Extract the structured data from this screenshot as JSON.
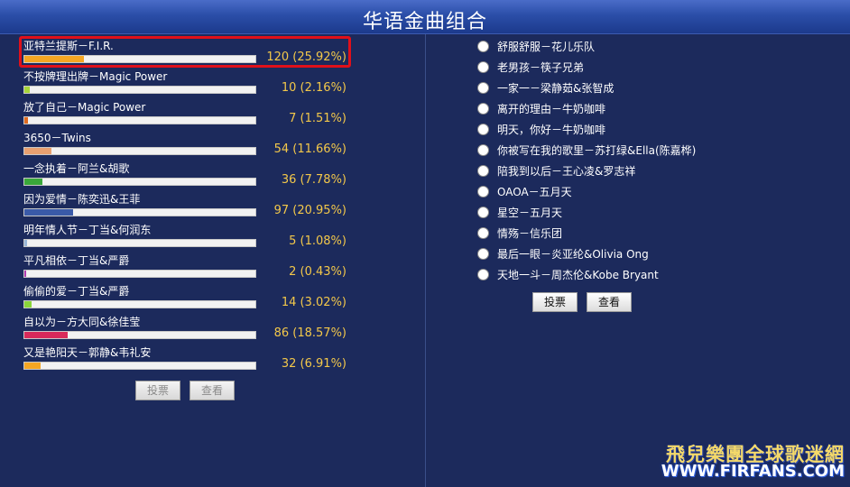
{
  "header": {
    "title": "华语金曲组合"
  },
  "results": [
    {
      "label": "亚特兰提斯－F.I.R.",
      "value": "120 (25.92%)",
      "percent": 25.92,
      "color": "#f5a623"
    },
    {
      "label": "不按牌理出牌－Magic Power",
      "value": "10 (2.16%)",
      "percent": 2.16,
      "color": "#a8d63a"
    },
    {
      "label": "放了自己－Magic Power",
      "value": "7 (1.51%)",
      "percent": 1.51,
      "color": "#e06a20"
    },
    {
      "label": "3650－Twins",
      "value": "54 (11.66%)",
      "percent": 11.66,
      "color": "#e8a070"
    },
    {
      "label": "一念执着－阿兰&胡歌",
      "value": "36 (7.78%)",
      "percent": 7.78,
      "color": "#3aa83a"
    },
    {
      "label": "因为爱情－陈奕迅&王菲",
      "value": "97 (20.95%)",
      "percent": 20.95,
      "color": "#3a5aa8"
    },
    {
      "label": "明年情人节－丁当&何润东",
      "value": "5 (1.08%)",
      "percent": 1.08,
      "color": "#9ab8d8"
    },
    {
      "label": "平凡相依－丁当&严爵",
      "value": "2 (0.43%)",
      "percent": 0.43,
      "color": "#b03ab0"
    },
    {
      "label": "偷偷的爱－丁当&严爵",
      "value": "14 (3.02%)",
      "percent": 3.02,
      "color": "#8ad63a"
    },
    {
      "label": "自以为－方大同&徐佳莹",
      "value": "86 (18.57%)",
      "percent": 18.57,
      "color": "#d82a5a"
    },
    {
      "label": "又是艳阳天－郭静&韦礼安",
      "value": "32 (6.91%)",
      "percent": 6.91,
      "color": "#f5a623"
    }
  ],
  "left_buttons": {
    "vote": "投票",
    "view": "查看"
  },
  "options": [
    "舒服舒服－花儿乐队",
    "老男孩－筷子兄弟",
    "一家一－梁静茹&张智成",
    "离开的理由－牛奶咖啡",
    "明天，你好－牛奶咖啡",
    "你被写在我的歌里－苏打绿&Ella(陈嘉桦)",
    "陪我到以后－王心凌&罗志祥",
    "OAOA－五月天",
    "星空－五月天",
    "情殇－信乐团",
    "最后一眼－炎亚纶&Olivia Ong",
    "天地一斗－周杰伦&Kobe Bryant"
  ],
  "right_buttons": {
    "vote": "投票",
    "view": "查看"
  },
  "logo": {
    "cn": "飛兒樂團全球歌迷網",
    "en": "WWW.FIRFANS.COM"
  }
}
